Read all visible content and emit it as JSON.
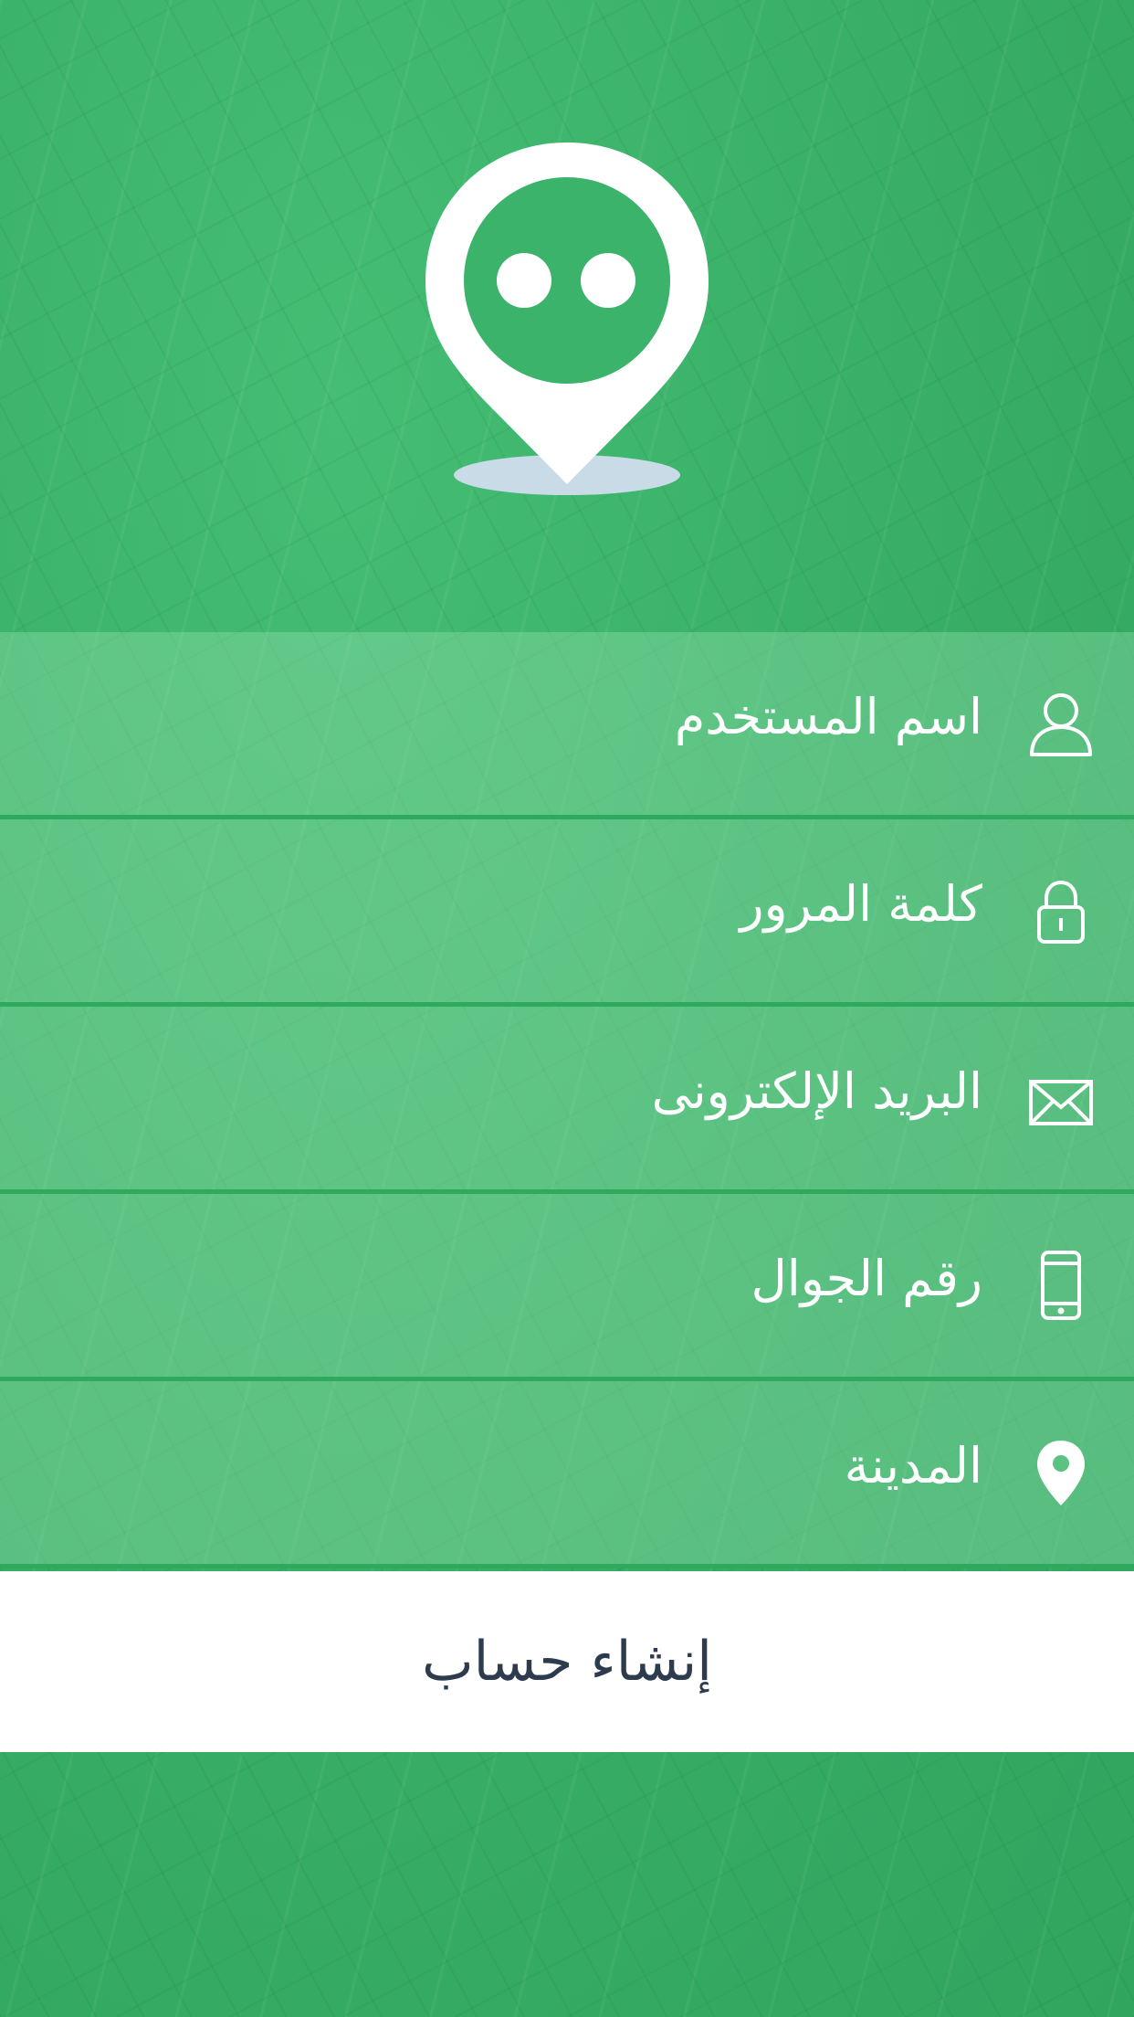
{
  "header": {
    "logo_icon": "map-pin-face-icon",
    "colors": {
      "background": "#3bb36a",
      "pin": "#ffffff",
      "pin_shadow": "#c9dbe6"
    }
  },
  "form": {
    "fields": [
      {
        "label": "اسم المستخدم",
        "icon": "user-icon"
      },
      {
        "label": "كلمة المرور",
        "icon": "lock-icon"
      },
      {
        "label": "البريد الإلكترونى",
        "icon": "envelope-icon"
      },
      {
        "label": "رقم الجوال",
        "icon": "mobile-phone-icon"
      },
      {
        "label": "المدينة",
        "icon": "location-pin-icon"
      }
    ],
    "divider_color": "#2ea95d"
  },
  "submit": {
    "label": "إنشاء حساب",
    "text_color": "#2c3b4d",
    "background": "#ffffff"
  }
}
